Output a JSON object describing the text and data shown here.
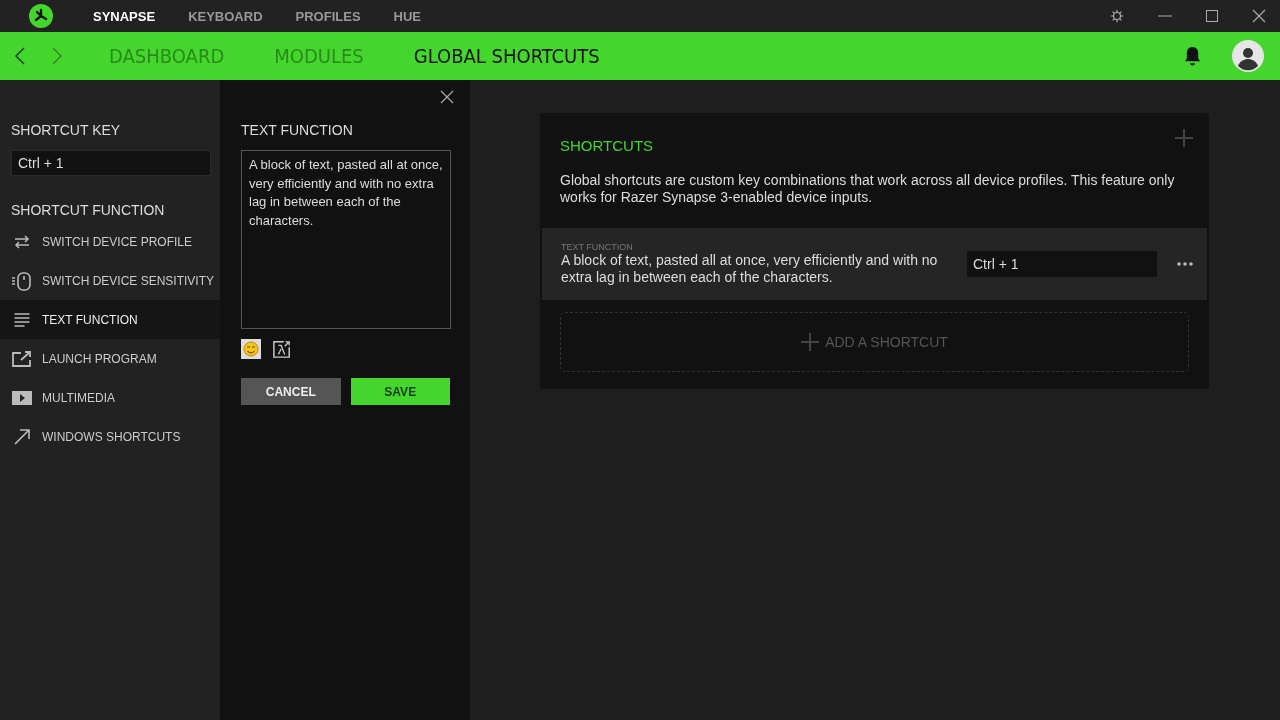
{
  "top_tabs": [
    {
      "label": "SYNAPSE",
      "selected": true
    },
    {
      "label": "KEYBOARD",
      "selected": false
    },
    {
      "label": "PROFILES",
      "selected": false
    },
    {
      "label": "HUE",
      "selected": false
    }
  ],
  "nav_tabs": [
    {
      "label": "DASHBOARD",
      "selected": false
    },
    {
      "label": "MODULES",
      "selected": false
    },
    {
      "label": "GLOBAL SHORTCUTS",
      "selected": true
    }
  ],
  "shortcut_key": {
    "heading": "SHORTCUT KEY",
    "value": "Ctrl + 1"
  },
  "shortcut_function": {
    "heading": "SHORTCUT FUNCTION",
    "items": [
      {
        "kind": "swap",
        "label": "SWITCH DEVICE PROFILE",
        "selected": false
      },
      {
        "kind": "mouse",
        "label": "SWITCH DEVICE SENSITIVITY",
        "selected": false
      },
      {
        "kind": "text",
        "label": "TEXT FUNCTION",
        "selected": true
      },
      {
        "kind": "launch",
        "label": "LAUNCH PROGRAM",
        "selected": false
      },
      {
        "kind": "play",
        "label": "MULTIMEDIA",
        "selected": false
      },
      {
        "kind": "arrow",
        "label": "WINDOWS SHORTCUTS",
        "selected": false
      }
    ]
  },
  "editor": {
    "heading": "TEXT FUNCTION",
    "value": "A block of text, pasted all at once, very efficiently and with no extra lag in between each of the characters.",
    "buttons": [
      "CANCEL",
      "SAVE"
    ]
  },
  "card": {
    "title": "SHORTCUTS",
    "description": "Global shortcuts are custom key combinations that work across all device profiles. This feature only works for Razer Synapse 3-enabled device inputs.",
    "shortcuts": [
      {
        "type": "TEXT FUNCTION",
        "text": "A block of text, pasted all at once, very efficiently and with no extra lag in between each of the characters.",
        "key": "Ctrl + 1"
      }
    ],
    "add_label": "ADD A SHORTCUT"
  }
}
